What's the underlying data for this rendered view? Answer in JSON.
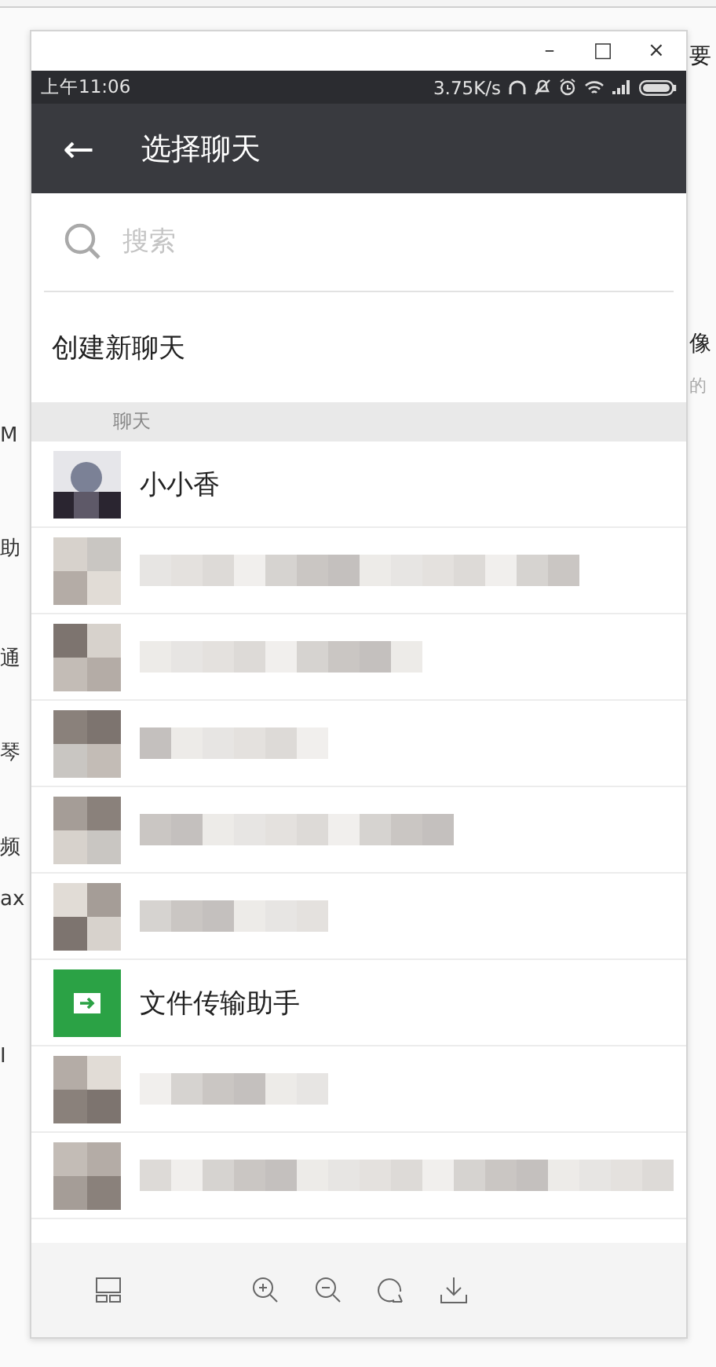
{
  "background": {
    "left_fragments": [
      "M",
      "助",
      "通",
      "琴",
      "频",
      "ax",
      "I"
    ],
    "right_fragments": [
      "要",
      "像",
      "的"
    ]
  },
  "window": {
    "controls": [
      "–",
      "□",
      "×"
    ]
  },
  "status_bar": {
    "time": "上午11:06",
    "speed": "3.75K/s"
  },
  "header": {
    "back": "←",
    "title": "选择聊天"
  },
  "search": {
    "placeholder": "搜索"
  },
  "create": "创建新聊天",
  "section": "聊天",
  "rows": [
    {
      "kind": "photo-contact",
      "name": "小小香"
    },
    {
      "kind": "blurred"
    },
    {
      "kind": "blurred"
    },
    {
      "kind": "blurred"
    },
    {
      "kind": "blurred"
    },
    {
      "kind": "blurred"
    },
    {
      "kind": "file-contact",
      "name": "文件传输助手"
    },
    {
      "kind": "blurred"
    },
    {
      "kind": "blurred"
    }
  ],
  "toolbar": [
    {
      "kind": "thumbnails"
    },
    {
      "kind": "zoom-in"
    },
    {
      "kind": "zoom-out"
    },
    {
      "kind": "rotate"
    },
    {
      "kind": "download"
    }
  ]
}
